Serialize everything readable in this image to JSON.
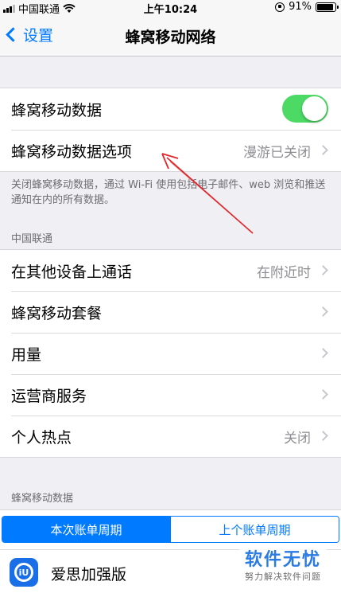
{
  "status_bar": {
    "carrier": "中国联通",
    "time": "上午10:24",
    "battery": "91%",
    "battery_level": 0.91
  },
  "nav": {
    "back_label": "设置",
    "title": "蜂窝移动网络"
  },
  "group1": {
    "cellular_data_label": "蜂窝移动数据",
    "cellular_data_on": true,
    "options_label": "蜂窝移动数据选项",
    "options_value": "漫游已关闭"
  },
  "footer_note": "关闭蜂窝移动数据，通过 Wi-Fi 使用包括电子邮件、web 浏览和推送通知在内的所有数据。",
  "carrier_section": {
    "header": "中国联通",
    "items": [
      {
        "label": "在其他设备上通话",
        "value": "在附近时"
      },
      {
        "label": "蜂窝移动套餐",
        "value": ""
      },
      {
        "label": "用量",
        "value": ""
      },
      {
        "label": "运营商服务",
        "value": ""
      },
      {
        "label": "个人热点",
        "value": "关闭"
      }
    ]
  },
  "usage_section": {
    "header": "蜂窝移动数据",
    "segments": [
      "本次账单周期",
      "上个账单周期"
    ],
    "app_name": "爱思加强版"
  },
  "watermark": {
    "title": "软件无忧",
    "subtitle": "努力解决软件问题"
  },
  "colors": {
    "accent": "#007aff",
    "toggle_on": "#4cd964",
    "annotation": "#e0262a"
  },
  "icons": [
    "wifi-icon",
    "back-chevron-icon",
    "rotation-lock-icon",
    "battery-icon",
    "chevron-right-icon",
    "app-icon"
  ]
}
